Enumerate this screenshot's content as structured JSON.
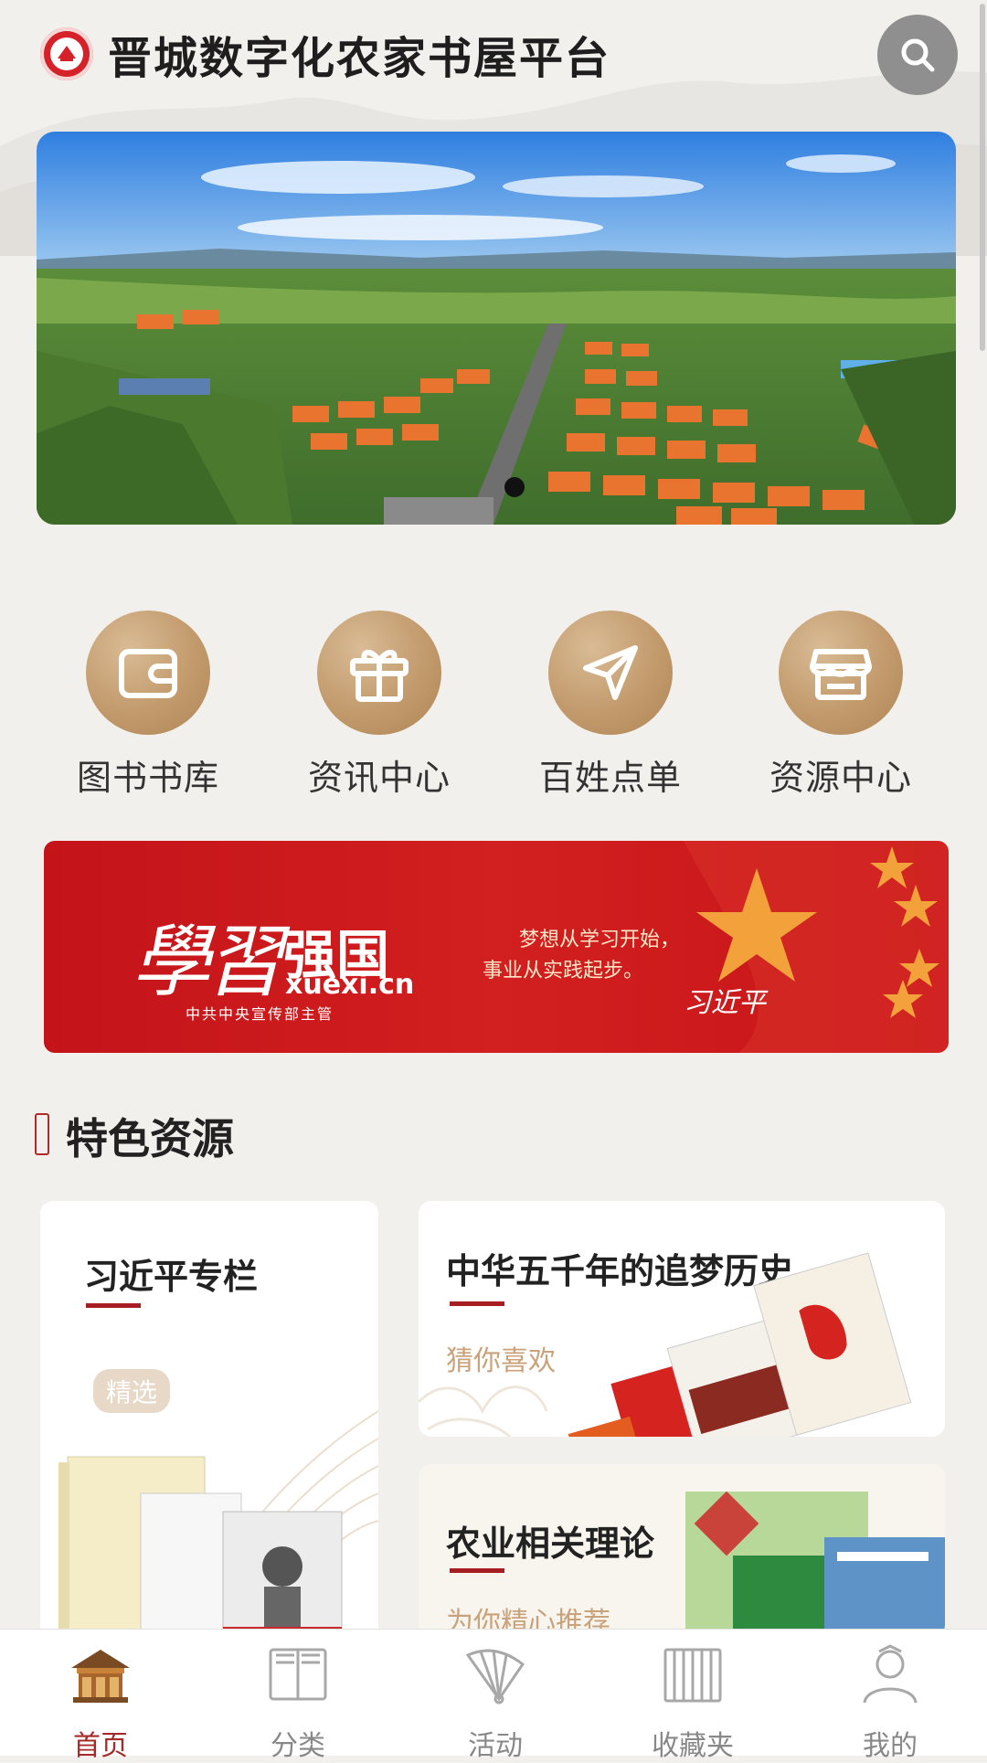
{
  "header": {
    "title": "晋城数字化农家书屋平台"
  },
  "icons": {
    "logo": "emblem-logo-icon",
    "search": "search-icon"
  },
  "quick_nav": [
    {
      "label": "图书书库",
      "icon": "wallet-icon"
    },
    {
      "label": "资讯中心",
      "icon": "gift-icon"
    },
    {
      "label": "百姓点单",
      "icon": "send-icon"
    },
    {
      "label": "资源中心",
      "icon": "store-icon"
    }
  ],
  "promo": {
    "brand_script": "學習",
    "brand_main": "强国",
    "domain": "xuexi.cn",
    "sponsor": "中共中央宣传部主管",
    "quote_line1": "梦想从学习开始，",
    "quote_line2": "事业从实践起步。",
    "signature": "习近平"
  },
  "section": {
    "title": "特色资源"
  },
  "cards": {
    "c1": {
      "title": "习近平专栏",
      "tag": "精选"
    },
    "c2": {
      "title": "中华五千年的追梦历史",
      "subtitle": "猜你喜欢"
    },
    "c3": {
      "title": "农业相关理论",
      "subtitle": "为你精心推荐"
    }
  },
  "bottom_nav": [
    {
      "label": "首页",
      "icon": "home-pavilion-icon",
      "active": true
    },
    {
      "label": "分类",
      "icon": "book-icon",
      "active": false
    },
    {
      "label": "活动",
      "icon": "fan-icon",
      "active": false
    },
    {
      "label": "收藏夹",
      "icon": "bookshelf-icon",
      "active": false
    },
    {
      "label": "我的",
      "icon": "user-icon",
      "active": false
    }
  ],
  "colors": {
    "accent_red": "#a52a2a",
    "gold": "#c29a6c",
    "background": "#f2f0ed"
  }
}
